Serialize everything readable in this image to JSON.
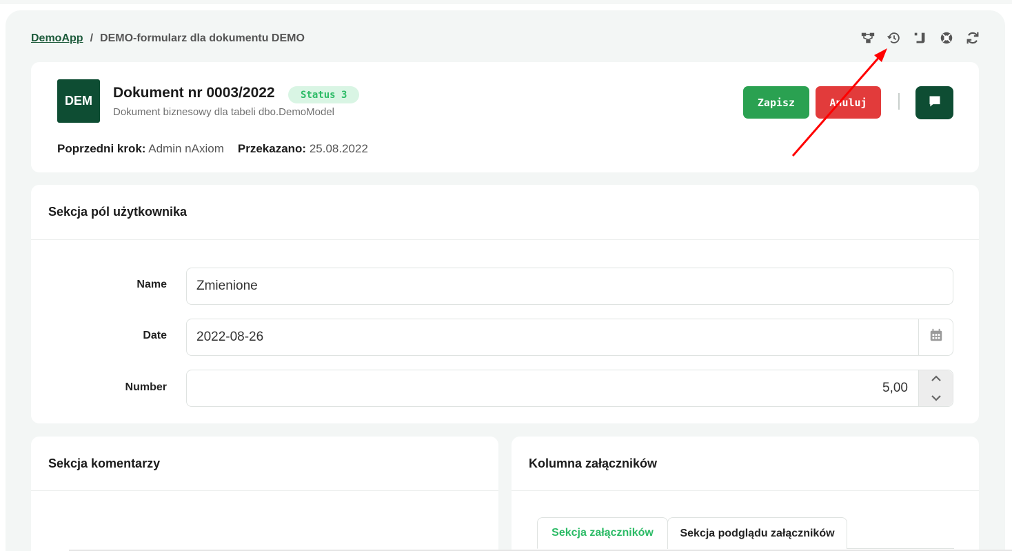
{
  "breadcrumb": {
    "app": "DemoApp",
    "separator": "/",
    "page": "DEMO-formularz dla dokumentu DEMO"
  },
  "toolbar": {
    "icons": [
      "workflow-icon",
      "history-icon",
      "scroll-icon",
      "help-icon",
      "refresh-icon"
    ]
  },
  "header": {
    "avatar": "DEM",
    "title": "Dokument nr 0003/2022",
    "status": "Status 3",
    "subtitle": "Dokument biznesowy dla tabeli dbo.DemoModel",
    "prev_step_label": "Poprzedni krok:",
    "prev_step_value": "Admin nAxiom",
    "passed_label": "Przekazano:",
    "passed_value": "25.08.2022",
    "save_label": "Zapisz",
    "cancel_label": "Anuluj"
  },
  "user_section": {
    "title": "Sekcja pól użytkownika",
    "fields": {
      "name_label": "Name",
      "name_value": "Zmienione",
      "date_label": "Date",
      "date_value": "2022-08-26",
      "number_label": "Number",
      "number_value": "5,00"
    }
  },
  "comments_section": {
    "title": "Sekcja komentarzy"
  },
  "attachments_section": {
    "title": "Kolumna załączników",
    "tabs": [
      {
        "label": "Sekcja załączników",
        "active": true
      },
      {
        "label": "Sekcja podglądu załączników",
        "active": false
      }
    ]
  },
  "colors": {
    "brand": "#0e4d33",
    "save": "#2aa151",
    "cancel": "#e23b3b",
    "status_text": "#2cbb66",
    "annotation_arrow": "#ff0000"
  }
}
